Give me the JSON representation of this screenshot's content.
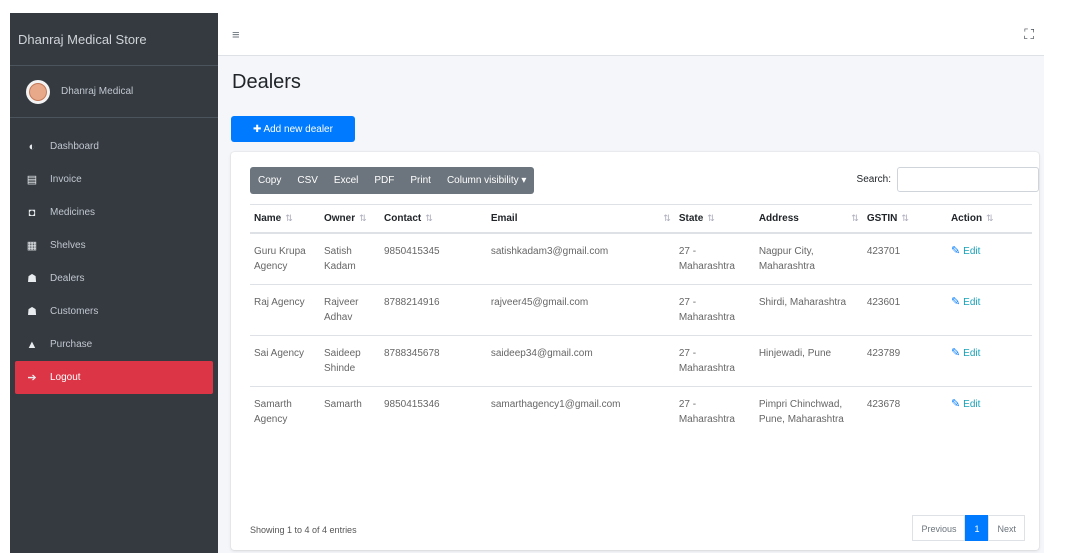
{
  "brand": "Dhanraj Medical Store",
  "user": {
    "name": "Dhanraj Medical"
  },
  "nav": [
    {
      "label": "Dashboard",
      "icon": "tachometer-icon",
      "glyph": "◐"
    },
    {
      "label": "Invoice",
      "icon": "invoice-icon",
      "glyph": "▤"
    },
    {
      "label": "Medicines",
      "icon": "camera-icon",
      "glyph": "◘"
    },
    {
      "label": "Shelves",
      "icon": "shelves-icon",
      "glyph": "▦"
    },
    {
      "label": "Dealers",
      "icon": "users-icon",
      "glyph": "☗"
    },
    {
      "label": "Customers",
      "icon": "users-icon",
      "glyph": "☗"
    },
    {
      "label": "Purchase",
      "icon": "shopping-bag-icon",
      "glyph": "▲"
    },
    {
      "label": "Logout",
      "icon": "sign-out-icon",
      "glyph": "➔"
    }
  ],
  "topbar": {
    "menu_glyph": "≡",
    "expand_glyph": "⛶"
  },
  "page_title": "Dealers",
  "add_button": "Add new dealer",
  "export_buttons": [
    "Copy",
    "CSV",
    "Excel",
    "PDF",
    "Print",
    "Column visibility ▾"
  ],
  "search_label": "Search:",
  "columns": [
    "Name",
    "Owner",
    "Contact",
    "Email",
    "State",
    "Address",
    "GSTIN",
    "Action"
  ],
  "rows": [
    {
      "name": "Guru Krupa Agency",
      "owner": "Satish Kadam",
      "contact": "9850415345",
      "email": "satishkadam3@gmail.com",
      "state": "27 - Maharashtra",
      "address": "Nagpur City, Maharashtra",
      "gstin": "423701",
      "action": "Edit"
    },
    {
      "name": "Raj Agency",
      "owner": "Rajveer Adhav",
      "contact": "8788214916",
      "email": "rajveer45@gmail.com",
      "state": "27 - Maharashtra",
      "address": "Shirdi, Maharashtra",
      "gstin": "423601",
      "action": "Edit"
    },
    {
      "name": "Sai Agency",
      "owner": "Saideep Shinde",
      "contact": "8788345678",
      "email": "saideep34@gmail.com",
      "state": "27 - Maharashtra",
      "address": "Hinjewadi, Pune",
      "gstin": "423789",
      "action": "Edit"
    },
    {
      "name": "Samarth Agency",
      "owner": "Samarth",
      "contact": "9850415346",
      "email": "samarthagency1@gmail.com",
      "state": "27 - Maharashtra",
      "address": "Pimpri Chinchwad, Pune, Maharashtra",
      "gstin": "423678",
      "action": "Edit"
    }
  ],
  "info": "Showing 1 to 4 of 4 entries",
  "pagination": {
    "previous": "Previous",
    "current": "1",
    "next": "Next"
  },
  "colors": {
    "sidebar": "#343a40",
    "active": "#dc3545",
    "primary": "#007bff"
  }
}
